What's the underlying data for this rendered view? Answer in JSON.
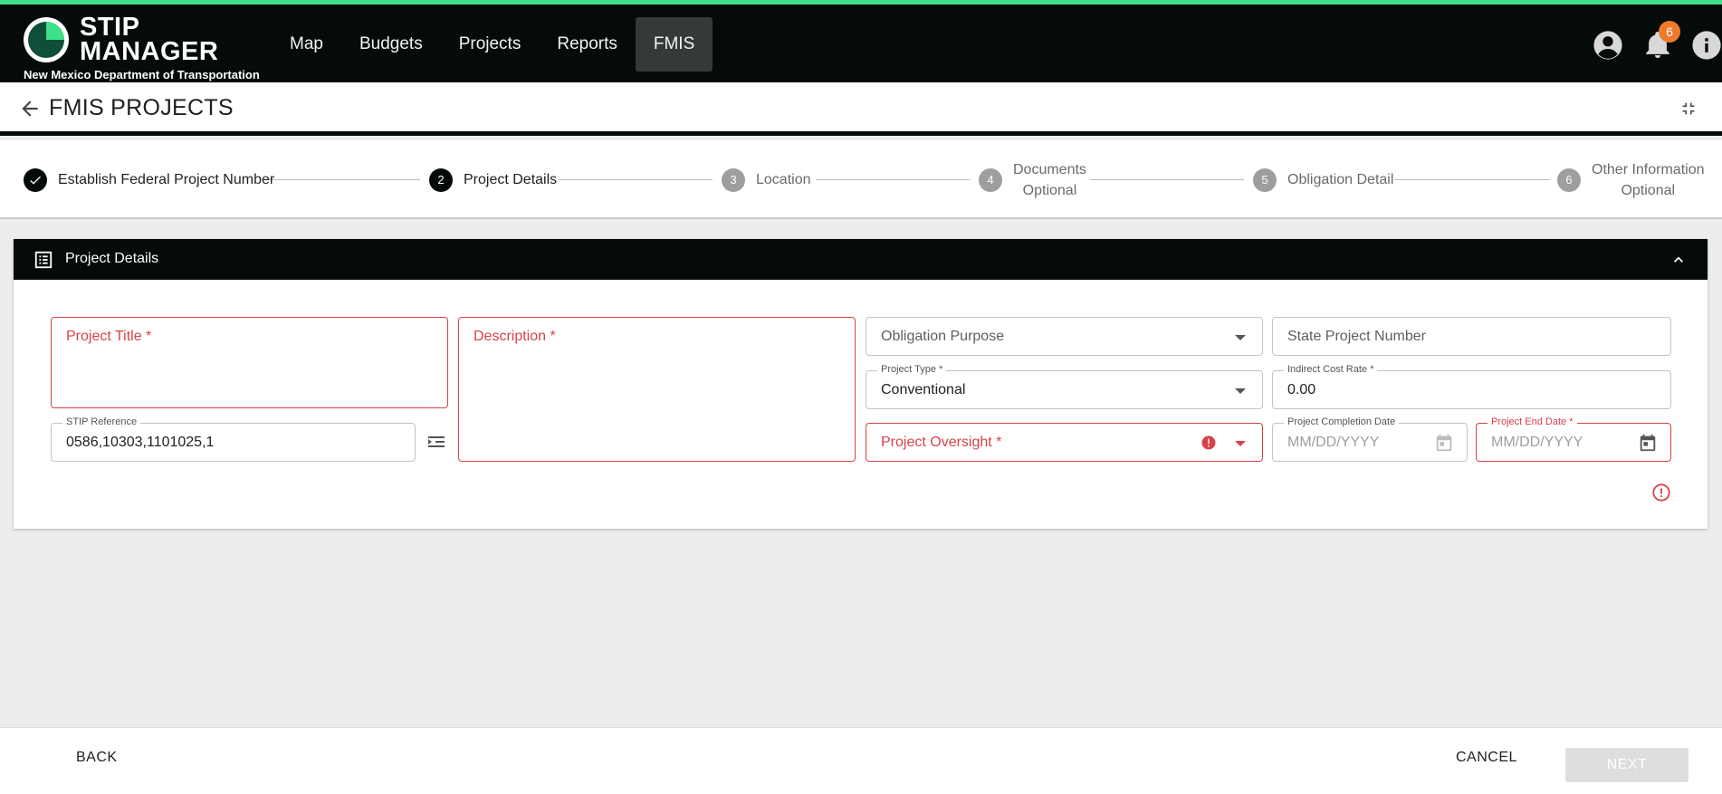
{
  "app": {
    "logo_line1": "STIP",
    "logo_line2": "MANAGER",
    "logo_sub": "New Mexico Department of Transportation"
  },
  "nav": {
    "items": [
      {
        "label": "Map"
      },
      {
        "label": "Budgets"
      },
      {
        "label": "Projects"
      },
      {
        "label": "Reports"
      },
      {
        "label": "FMIS",
        "active": true
      }
    ]
  },
  "header": {
    "notification_count": "6",
    "icons": [
      "account-icon",
      "bell-icon",
      "info-icon"
    ]
  },
  "page": {
    "title": "FMIS PROJECTS"
  },
  "stepper": {
    "steps": [
      {
        "number": "1",
        "label": "Establish Federal Project Number",
        "status": "done"
      },
      {
        "number": "2",
        "label": "Project Details",
        "status": "current"
      },
      {
        "number": "3",
        "label": "Location",
        "status": "pending"
      },
      {
        "number": "4",
        "label": "Documents",
        "sub": "Optional",
        "status": "pending"
      },
      {
        "number": "5",
        "label": "Obligation Detail",
        "status": "pending"
      },
      {
        "number": "6",
        "label": "Other Information",
        "sub": "Optional",
        "status": "pending"
      }
    ]
  },
  "card": {
    "title": "Project Details",
    "fields": {
      "project_title": {
        "placeholder": "Project Title *"
      },
      "description": {
        "placeholder": "Description *"
      },
      "stip_reference": {
        "label": "STIP Reference",
        "value": "0586,10303,1101025,1"
      },
      "obligation_purpose": {
        "placeholder": "Obligation Purpose"
      },
      "state_project_number": {
        "placeholder": "State Project Number"
      },
      "project_type": {
        "label": "Project Type *",
        "value": "Conventional"
      },
      "indirect_cost_rate": {
        "label": "Indirect Cost Rate *",
        "value": "0.00"
      },
      "project_oversight": {
        "placeholder": "Project Oversight *"
      },
      "project_completion_date": {
        "label": "Project Completion Date",
        "placeholder": "MM/DD/YYYY"
      },
      "project_end_date": {
        "label": "Project End Date *",
        "placeholder": "MM/DD/YYYY"
      }
    }
  },
  "footer": {
    "back_label": "BACK",
    "cancel_label": "CANCEL",
    "next_label": "NEXT"
  },
  "colors": {
    "accent_green": "#3ee08a",
    "header_bg": "#050b0a",
    "error_red": "#d9414a",
    "badge_orange": "#f07a2b"
  }
}
